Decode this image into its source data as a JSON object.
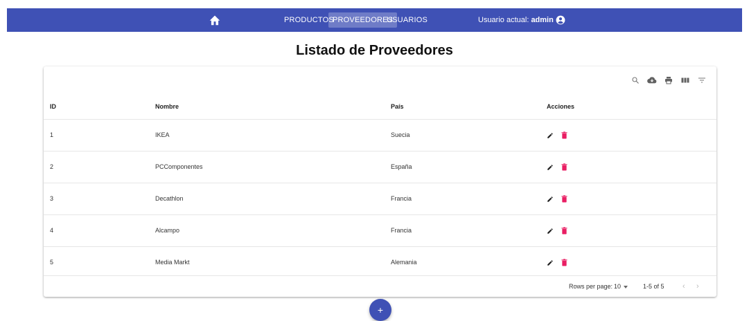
{
  "nav": {
    "items": [
      {
        "label": "PRODUCTOS",
        "active": false
      },
      {
        "label": "PROVEEDORES",
        "active": true
      },
      {
        "label": "USUARIOS",
        "active": false
      }
    ],
    "user_prefix": "Usuario actual: ",
    "user_name": "admin",
    "home_icon": "home-icon",
    "user_icon": "account-circle-icon"
  },
  "page": {
    "title": "Listado de Proveedores"
  },
  "table": {
    "toolbar_icons": [
      "search-icon",
      "cloud-download-icon",
      "print-icon",
      "columns-icon",
      "filter-icon"
    ],
    "columns": [
      "ID",
      "Nombre",
      "País",
      "Acciones"
    ],
    "rows": [
      {
        "id": "1",
        "nombre": "IKEA",
        "pais": "Suecia"
      },
      {
        "id": "2",
        "nombre": "PCComponentes",
        "pais": "España"
      },
      {
        "id": "3",
        "nombre": "Decathlon",
        "pais": "Francia"
      },
      {
        "id": "4",
        "nombre": "Alcampo",
        "pais": "Francia"
      },
      {
        "id": "5",
        "nombre": "Media Markt",
        "pais": "Alemania"
      }
    ],
    "footer": {
      "rows_per_page_label": "Rows per page:",
      "rows_per_page_value": "10",
      "range": "1-5 of 5",
      "prev": "‹",
      "next": "›"
    }
  },
  "fab": {
    "label": "+"
  },
  "colors": {
    "primary": "#3f51b5",
    "delete": "#e91e63",
    "edit": "#212121"
  }
}
